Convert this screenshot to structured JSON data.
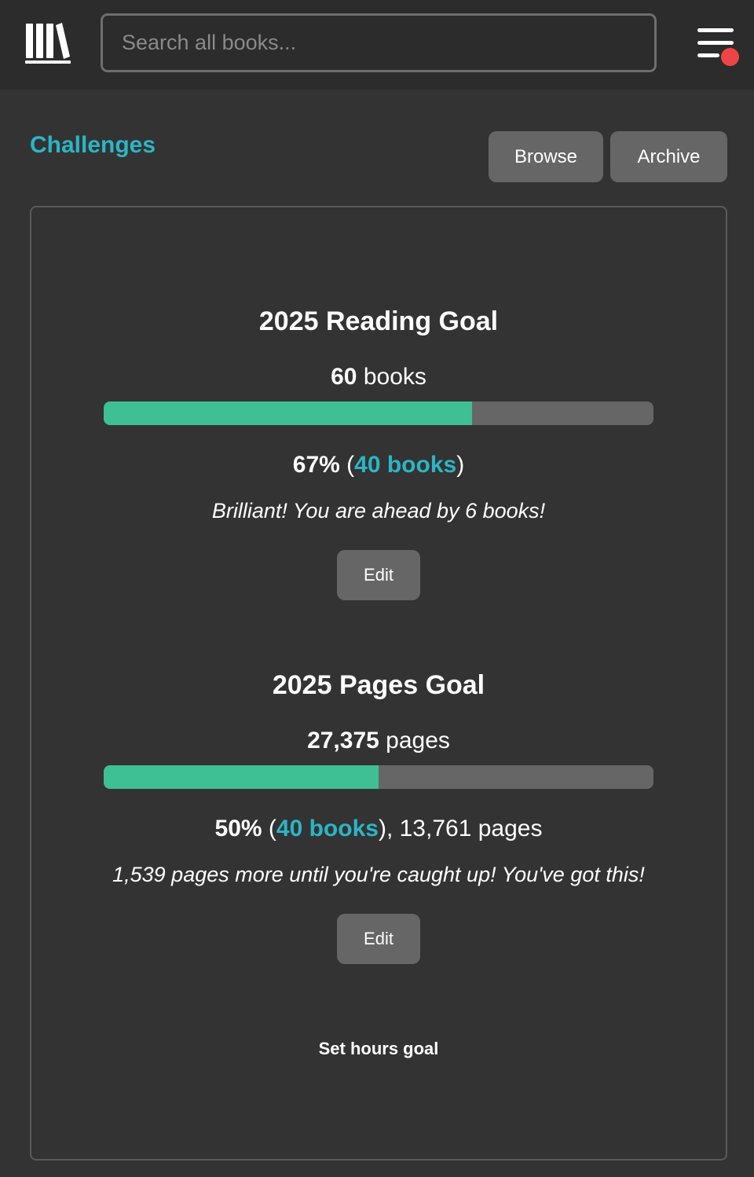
{
  "header": {
    "search_placeholder": "Search all books...",
    "logo_icon": "bookshelf-icon",
    "menu_icon": "hamburger-icon",
    "notification_color": "#ef4444"
  },
  "page": {
    "title": "Challenges",
    "browse_label": "Browse",
    "archive_label": "Archive"
  },
  "colors": {
    "accent": "#2bb5c4",
    "progress_fill": "#3fbf94",
    "progress_track": "#666666",
    "background": "#333333"
  },
  "goals": [
    {
      "title": "2025 Reading Goal",
      "target_value": "60",
      "target_unit": "books",
      "progress_fraction": 0.67,
      "percent": "67%",
      "books_read": "40 books",
      "pages_read": "",
      "message": "Brilliant! You are ahead by 6 books!",
      "edit_label": "Edit"
    },
    {
      "title": "2025 Pages Goal",
      "target_value": "27,375",
      "target_unit": "pages",
      "progress_fraction": 0.5,
      "percent": "50%",
      "books_read": "40 books",
      "pages_read": "13,761 pages",
      "message": "1,539 pages more until you're caught up! You've got this!",
      "edit_label": "Edit"
    }
  ],
  "hours_goal_label": "Set hours goal"
}
